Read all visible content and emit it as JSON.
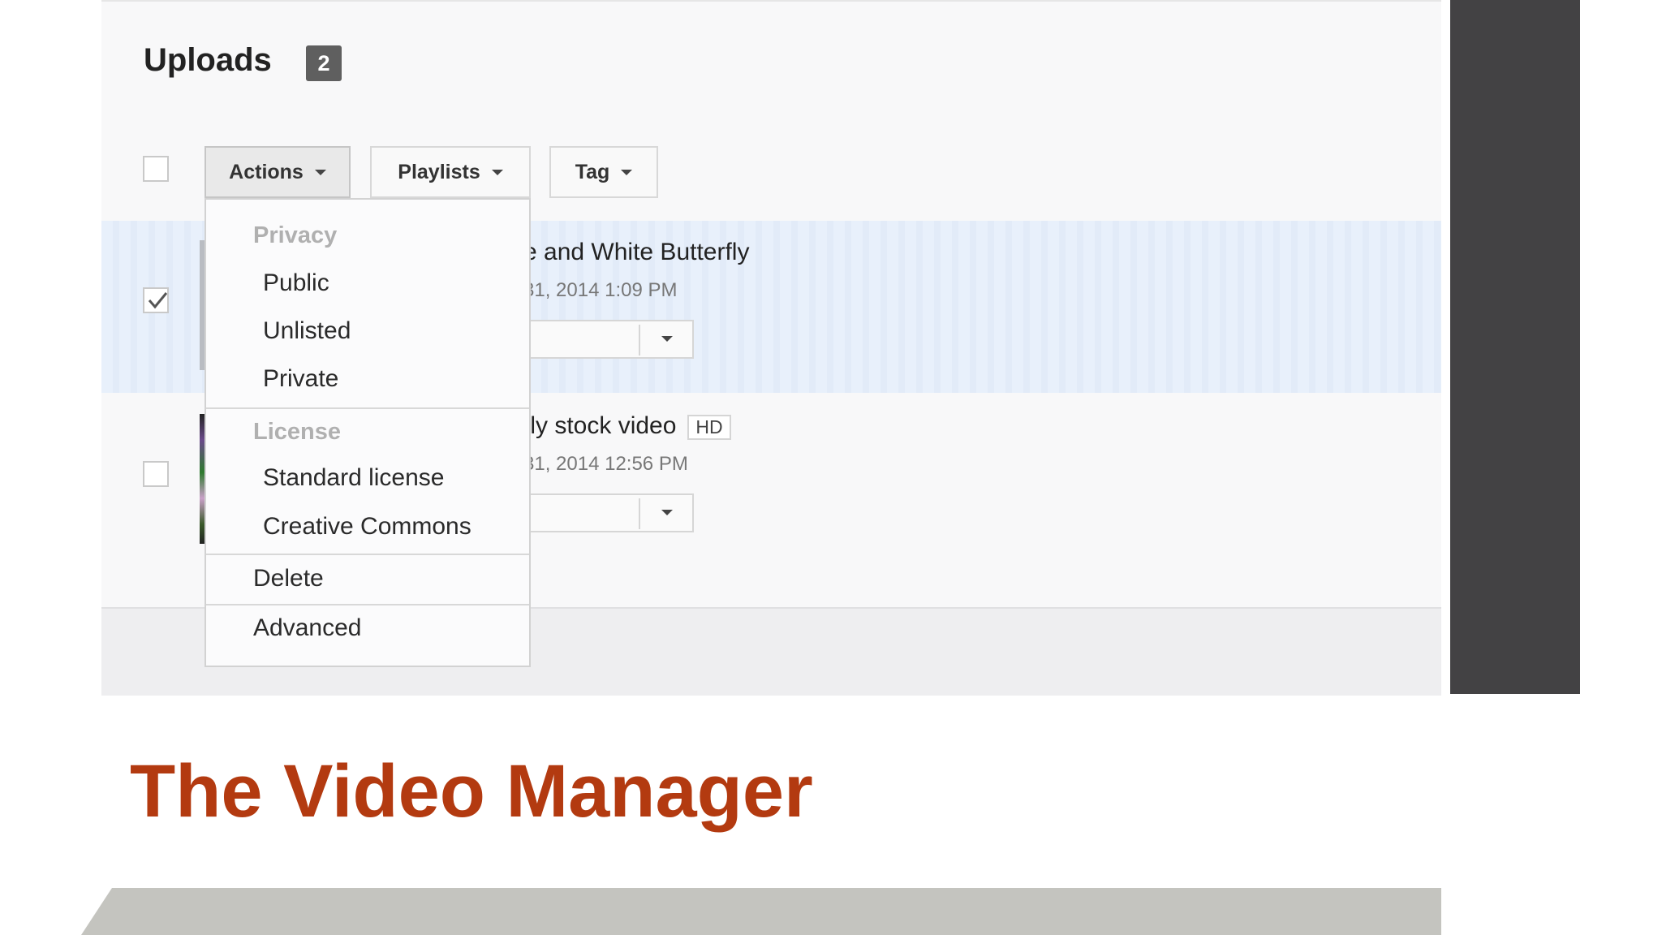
{
  "header": {
    "title": "Uploads",
    "count": "2"
  },
  "toolbar": {
    "actions_label": "Actions",
    "playlists_label": "Playlists",
    "tag_label": "Tag"
  },
  "videos": [
    {
      "title": "e and White Butterfly",
      "date": "31, 2014 1:09 PM",
      "selected": true
    },
    {
      "title": "fly stock video",
      "badge": "HD",
      "date": "31, 2014 12:56 PM",
      "selected": false
    }
  ],
  "actions_menu": {
    "privacy_header": "Privacy",
    "privacy_items": [
      "Public",
      "Unlisted",
      "Private"
    ],
    "license_header": "License",
    "license_items": [
      "Standard license",
      "Creative Commons"
    ],
    "delete_label": "Delete",
    "advanced_label": "Advanced"
  },
  "slide": {
    "title": "The Video Manager"
  },
  "colors": {
    "slide_title": "#b33a10",
    "selected_row": "#e8f0fb",
    "dark_panel": "#434244"
  }
}
